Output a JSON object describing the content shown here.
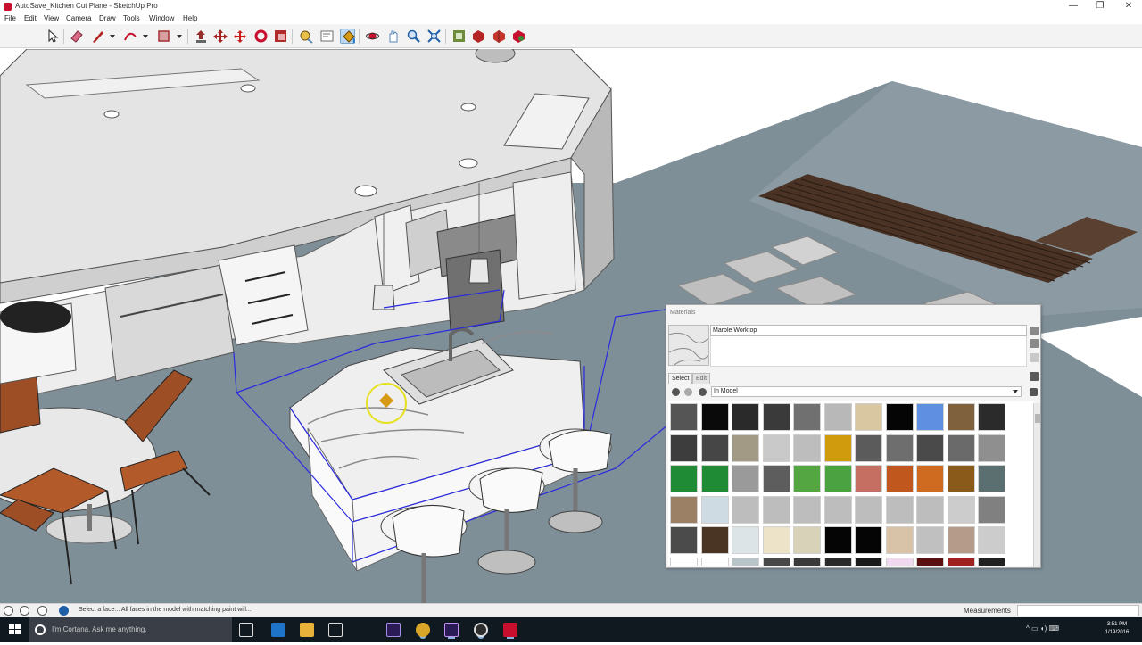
{
  "window": {
    "title": "AutoSave_Kitchen Cut Plane - SketchUp Pro",
    "min_glyph": "—",
    "max_glyph": "❐",
    "close_glyph": "✕"
  },
  "menu": {
    "file": "File",
    "edit": "Edit",
    "view": "View",
    "camera": "Camera",
    "draw": "Draw",
    "tools": "Tools",
    "window": "Window",
    "help": "Help"
  },
  "toolbar": {
    "icons": [
      "select-icon",
      "eraser-icon",
      "pencil-icon",
      "arc-icon",
      "rectangle-icon",
      "push-pull-icon",
      "move-icon",
      "rotate-icon",
      "scale-icon",
      "offset-icon",
      "tape-measure-icon",
      "text-icon",
      "paint-bucket-icon",
      "orbit-icon",
      "pan-icon",
      "zoom-icon",
      "zoom-extents-icon",
      "3d-warehouse-icon",
      "extension-warehouse-icon",
      "layout-icon",
      "extension-manager-icon"
    ],
    "active_tool": "paint-bucket-icon",
    "accent": "#c8102e"
  },
  "materials": {
    "panel_title": "Materials",
    "material_name": "Marble Worktop",
    "tabs": {
      "select": "Select",
      "edit": "Edit"
    },
    "library": "In Model",
    "swatch_colors": [
      [
        "#555555",
        "#0a0a0a",
        "#2a2a2a",
        "#3a3a3a",
        "#707070",
        "#b8b8b8",
        "#d9c7a1",
        "#050505",
        "#5f8fe0",
        "#80613d",
        "#2b2b2b"
      ],
      [
        "#3d3d3d",
        "#464646",
        "#a39a86",
        "#c9c9c9",
        "#bdbdbd",
        "#d19b0e",
        "#5b5b5b",
        "#6e6e6e",
        "#4a4a4a",
        "#6a6a6a",
        "#8f8f8f"
      ],
      [
        "#1f8b35",
        "#1f8b35",
        "#9a9a9a",
        "#5d5d5d",
        "#54a642",
        "#4aa240",
        "#c46f61",
        "#c0581e",
        "#cf6b20",
        "#8a5a1a",
        "#5c6f70"
      ],
      [
        "#9b8066",
        "#cfdbe3",
        "#bdbdbd",
        "#bdbdbd",
        "#bdbdbd",
        "#bdbdbd",
        "#bdbdbd",
        "#bdbdbd",
        "#bdbdbd",
        "#cccccc",
        "#808080"
      ],
      [
        "#4b4b4b",
        "#4a3424",
        "#dde4e8",
        "#ece3c8",
        "#d7d2b8",
        "#050505",
        "#050505",
        "#d8c2a8",
        "#c0c0c0",
        "#b49b8a",
        "#cccccc"
      ],
      [
        "#ffffff",
        "#ffffff",
        "#b8c4c8",
        "#484848",
        "#3a3a3a",
        "#2a2a2a",
        "#1a1a1a",
        "#f0d8ee",
        "#5a1010",
        "#a02020",
        "#202020"
      ]
    ]
  },
  "statusbar": {
    "hint": "Select a face... All faces in the model with matching paint will...",
    "measurements_label": "Measurements"
  },
  "taskbar": {
    "search_placeholder": "I'm Cortana. Ask me anything.",
    "apps": [
      "task-view-icon",
      "edge-icon",
      "file-explorer-icon",
      "store-icon",
      "premiere-icon",
      "chrome-icon",
      "after-effects-icon",
      "obs-icon",
      "sketchup-icon"
    ],
    "tray_glyphs": "^ ▭ ◖) ⌨",
    "time": "3:51 PM",
    "date": "1/19/2016"
  },
  "icon_colors": {
    "select": "#222222",
    "eraser": "#d96a86",
    "pencil": "#b41f1f",
    "arc": "#c8102e",
    "rectangle": "#a23030",
    "pushpull": "#9a2b2b",
    "move": "#a52222",
    "rotate": "#c81e1e",
    "scale": "#c8102e",
    "offset": "#b02a2a",
    "tape": "#5a86b8",
    "text": "#6d6d6d",
    "paint": "#d79a17",
    "orbit": "#c8102e",
    "pan": "#5a86b8",
    "zoom": "#1f5fa8",
    "zoomext": "#1f5fa8",
    "warehouse": "#6f8b3d",
    "ext": "#b52525",
    "layout": "#c2352a",
    "extmgr": "#c8102e"
  }
}
